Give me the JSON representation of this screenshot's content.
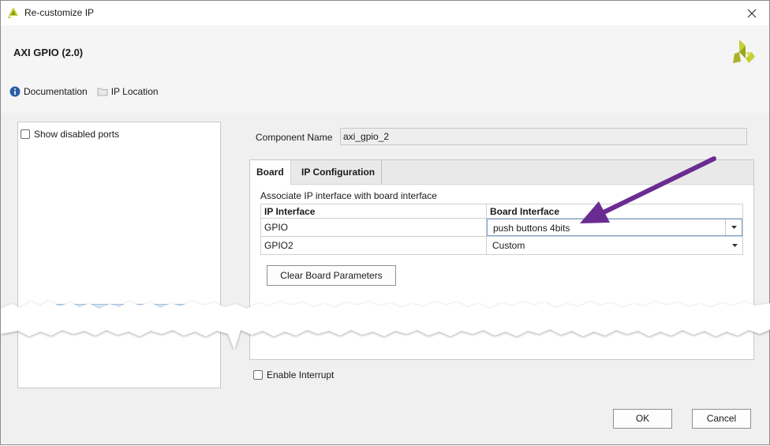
{
  "window": {
    "title": "Re-customize IP",
    "close_icon": "close-icon"
  },
  "header": {
    "ip_title": "AXI GPIO (2.0)",
    "links": [
      {
        "icon": "info-icon",
        "label": "Documentation"
      },
      {
        "icon": "folder-icon",
        "label": "IP Location"
      }
    ]
  },
  "left_panel": {
    "show_disabled_ports_label": "Show disabled ports",
    "show_disabled_ports_checked": false
  },
  "component": {
    "label": "Component Name",
    "value": "axi_gpio_2"
  },
  "tabs": [
    {
      "label": "Board",
      "active": true
    },
    {
      "label": "IP Configuration",
      "active": false
    }
  ],
  "board": {
    "associate_label": "Associate IP interface with board interface",
    "columns": [
      "IP Interface",
      "Board Interface"
    ],
    "rows": [
      {
        "ip_interface": "GPIO",
        "board_interface": "push buttons 4bits"
      },
      {
        "ip_interface": "GPIO2",
        "board_interface": "Custom"
      }
    ],
    "clear_button": "Clear Board Parameters"
  },
  "interrupt": {
    "label": "Enable Interrupt",
    "checked": false
  },
  "footer": {
    "ok_label": "OK",
    "cancel_label": "Cancel"
  },
  "colors": {
    "annotation_arrow": "#6a2c91",
    "logo_light": "#c5cf3a",
    "logo_dark": "#9aa421"
  }
}
